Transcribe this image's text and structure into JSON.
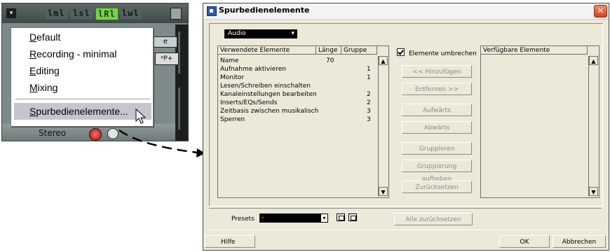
{
  "left": {
    "buttons": [
      "lml",
      "lsl",
      "lRl",
      "lwl"
    ],
    "mini_label_1": "e",
    "mini_label_2": "ᵖP+",
    "stereo": "Stereo",
    "menu_items": [
      {
        "first": "D",
        "rest": "efault"
      },
      {
        "first": "R",
        "rest": "ecording - minimal"
      },
      {
        "first": "E",
        "rest": "diting"
      },
      {
        "first": "M",
        "rest": "ixing"
      },
      {
        "first": "S",
        "rest": "purbedienelemente..."
      }
    ]
  },
  "dialog": {
    "title": "Spurbedienelemente",
    "close": "✕",
    "type_dropdown": "Audio",
    "list_headers": [
      "Verwendete Elemente",
      "Länge",
      "Gruppe"
    ],
    "rows": [
      {
        "name": "Name",
        "length": "70",
        "group": ""
      },
      {
        "name": "Aufnahme aktivieren",
        "length": "",
        "group": "1"
      },
      {
        "name": "Monitor",
        "length": "",
        "group": "1"
      },
      {
        "name": "Lesen/Schreiben einschalten",
        "length": "",
        "group": ""
      },
      {
        "name": "Kanaleinstellungen bearbeiten",
        "length": "",
        "group": "2"
      },
      {
        "name": "Inserts/EQs/Sends",
        "length": "",
        "group": "2"
      },
      {
        "name": "Zeitbasis zwischen musikalisch",
        "length": "",
        "group": "3"
      },
      {
        "name": "Sperren",
        "length": "",
        "group": "3"
      }
    ],
    "wrap_checkbox_label": "Elemente umbrechen",
    "wrap_checked": true,
    "buttons": {
      "add": "<< Hinzufügen",
      "remove": "Entfernen >>",
      "up": "Aufwärts",
      "down": "Abwärts",
      "group": "Gruppieren",
      "ungroup": "Gruppierung aufheben",
      "reset": "Zurücksetzen",
      "reset_all": "Alle zurücksetzen",
      "help": "Hilfe",
      "ok": "OK",
      "cancel": "Abbrechen"
    },
    "available_header": "Verfügbare Elemente",
    "presets_label": "Presets",
    "presets_value": "-"
  }
}
